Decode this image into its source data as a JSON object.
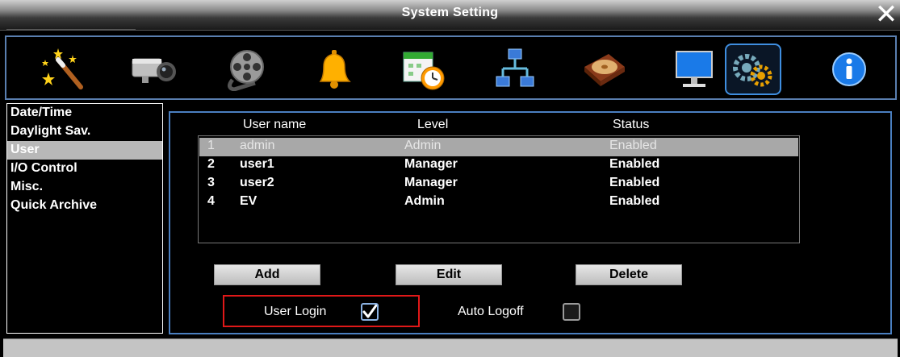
{
  "window": {
    "title": "System Setting"
  },
  "toolbar": {
    "icons": [
      "magic-wand-icon",
      "camera-icon",
      "film-reel-icon",
      "bell-icon",
      "schedule-icon",
      "network-icon",
      "hard-disk-icon",
      "monitor-icon",
      "system-settings-icon",
      "info-icon"
    ]
  },
  "sidebar": {
    "items": [
      {
        "label": "Date/Time"
      },
      {
        "label": "Daylight Sav."
      },
      {
        "label": "User"
      },
      {
        "label": "I/O Control"
      },
      {
        "label": "Misc."
      },
      {
        "label": "Quick Archive"
      }
    ]
  },
  "users": {
    "headers": {
      "name": "User name",
      "level": "Level",
      "status": "Status"
    },
    "rows": [
      {
        "num": "1",
        "name": "admin",
        "level": "Admin",
        "status": "Enabled"
      },
      {
        "num": "2",
        "name": "user1",
        "level": "Manager",
        "status": "Enabled"
      },
      {
        "num": "3",
        "name": "user2",
        "level": "Manager",
        "status": "Enabled"
      },
      {
        "num": "4",
        "name": "EV",
        "level": "Admin",
        "status": "Enabled"
      }
    ]
  },
  "buttons": {
    "add": "Add",
    "edit": "Edit",
    "delete": "Delete"
  },
  "options": {
    "user_login": {
      "label": "User Login",
      "checked": true
    },
    "auto_logoff": {
      "label": "Auto Logoff",
      "checked": false
    }
  },
  "colors": {
    "panel_border": "#4a7fc0",
    "selection": "#a8a8a8",
    "highlight": "#e01818"
  }
}
